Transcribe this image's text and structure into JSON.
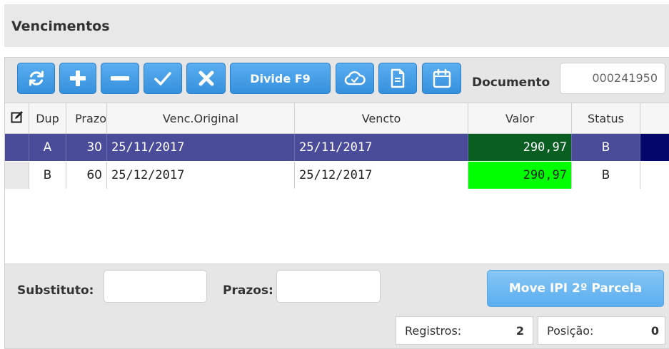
{
  "header": {
    "title": "Vencimentos"
  },
  "toolbar": {
    "divide_label": "Divide F9",
    "documento_label": "Documento",
    "documento_value": "000241950",
    "icons": [
      "refresh-icon",
      "plus-icon",
      "minus-icon",
      "check-icon",
      "close-icon",
      "cloud-icon",
      "document-icon",
      "calendar-icon"
    ]
  },
  "grid": {
    "columns": [
      "Dup",
      "Prazo",
      "Venc.Original",
      "Vencto",
      "Valor",
      "Status"
    ],
    "rows": [
      {
        "dup": "A",
        "prazo": "30",
        "venc_original": "25/11/2017",
        "vencto": "25/11/2017",
        "valor": "290,97",
        "status": "B"
      },
      {
        "dup": "B",
        "prazo": "60",
        "venc_original": "25/12/2017",
        "vencto": "25/12/2017",
        "valor": "290,97",
        "status": "B"
      }
    ]
  },
  "footer": {
    "substituto_label": "Substituto:",
    "prazos_label": "Prazos:",
    "move_ipi_label": "Move IPI 2º Parcela",
    "registros_label": "Registros:",
    "registros_value": "2",
    "posicao_label": "Posição:",
    "posicao_value": "0"
  },
  "colors": {
    "toolbar_button": "#3f9be6",
    "selected_row": "#4a4c99",
    "valor_selected": "#0b5e22",
    "valor_normal": "#00ff00"
  }
}
